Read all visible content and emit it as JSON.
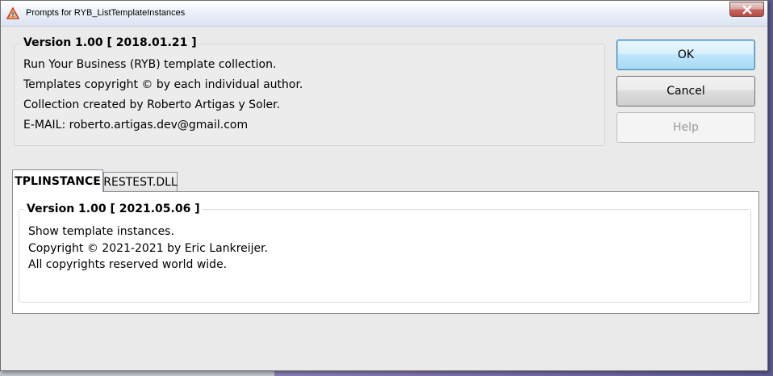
{
  "window": {
    "title": "Prompts for RYB_ListTemplateInstances"
  },
  "about": {
    "group_title": "Version 1.00 [ 2018.01.21 ]",
    "lines": [
      "Run Your Business (RYB) template collection.",
      "Templates copyright © by each individual author.",
      "Collection created by Roberto Artigas y Soler.",
      "E-MAIL: roberto.artigas.dev@gmail.com"
    ]
  },
  "buttons": {
    "ok": "OK",
    "cancel": "Cancel",
    "help": "Help"
  },
  "tabs": [
    {
      "label": "TPLINSTANCE",
      "active": true
    },
    {
      "label": "RESTEST.DLL",
      "active": false
    }
  ],
  "tab_content": {
    "group_title": "Version 1.00 [ 2021.05.06 ]",
    "lines": [
      "Show template instances.",
      "Copyright © 2021-2021 by Eric Lankreijer.",
      "All copyrights reserved world wide."
    ]
  },
  "icons": {
    "app": "triangle-app-icon",
    "close": "close-icon"
  },
  "colors": {
    "default_button_border": "#3c7fb1",
    "close_button": "#c7675f"
  }
}
